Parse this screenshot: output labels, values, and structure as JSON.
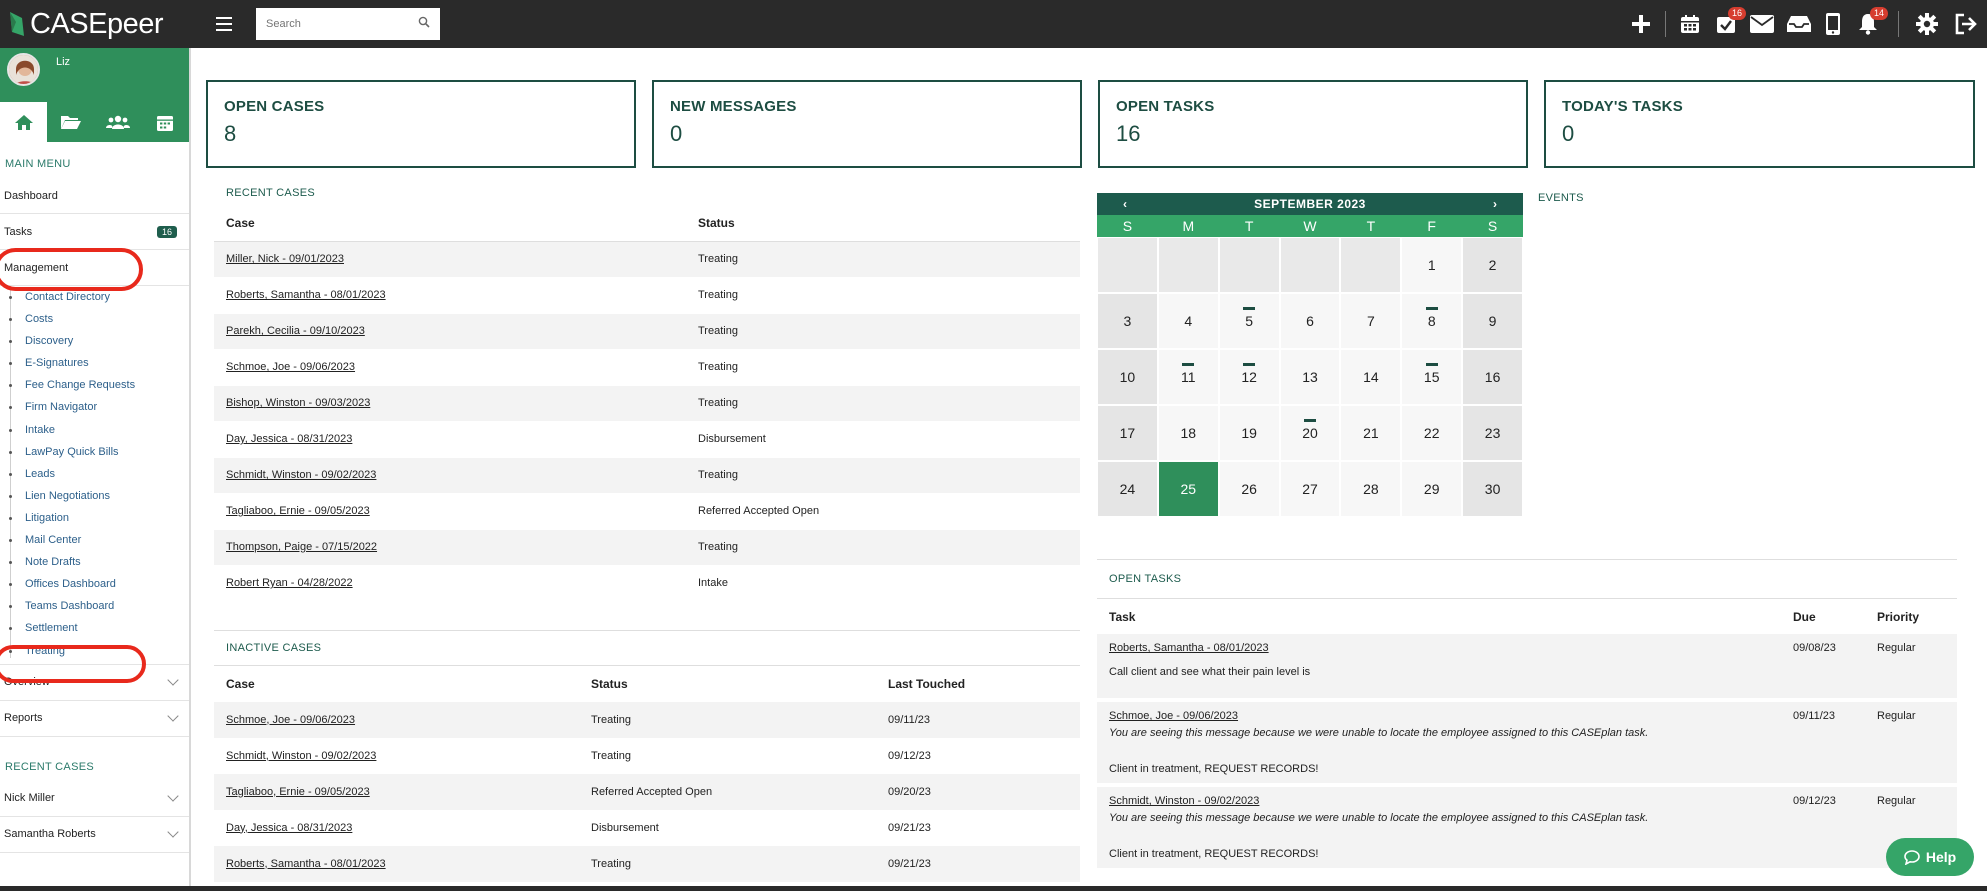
{
  "topbar": {
    "logo_text": "CASEpeer",
    "search_placeholder": "Search",
    "badge_tasks": "16",
    "badge_notifications": "14"
  },
  "sidebar": {
    "username": "Liz",
    "main_menu_label": "MAIN MENU",
    "items": {
      "dashboard": "Dashboard",
      "tasks": "Tasks",
      "tasks_count": "16",
      "management": "Management",
      "overview": "Overview",
      "reports": "Reports"
    },
    "management_sub": [
      "Contact Directory",
      "Costs",
      "Discovery",
      "E-Signatures",
      "Fee Change Requests",
      "Firm Navigator",
      "Intake",
      "LawPay Quick Bills",
      "Leads",
      "Lien Negotiations",
      "Litigation",
      "Mail Center",
      "Note Drafts",
      "Offices Dashboard",
      "Teams Dashboard",
      "Settlement",
      "Treating"
    ],
    "recent_cases_label": "RECENT CASES",
    "recent_cases": [
      "Nick Miller",
      "Samantha Roberts"
    ]
  },
  "stats": [
    {
      "label": "OPEN CASES",
      "value": "8"
    },
    {
      "label": "NEW MESSAGES",
      "value": "0"
    },
    {
      "label": "OPEN TASKS",
      "value": "16"
    },
    {
      "label": "TODAY'S TASKS",
      "value": "0"
    }
  ],
  "recent_cases": {
    "title": "RECENT CASES",
    "headers": [
      "Case",
      "Status"
    ],
    "rows": [
      [
        "Miller, Nick - 09/01/2023",
        "Treating"
      ],
      [
        "Roberts, Samantha - 08/01/2023",
        "Treating"
      ],
      [
        "Parekh, Cecilia - 09/10/2023",
        "Treating"
      ],
      [
        "Schmoe, Joe - 09/06/2023",
        "Treating"
      ],
      [
        "Bishop, Winston - 09/03/2023",
        "Treating"
      ],
      [
        "Day, Jessica - 08/31/2023",
        "Disbursement"
      ],
      [
        "Schmidt, Winston - 09/02/2023",
        "Treating"
      ],
      [
        "Tagliaboo, Ernie - 09/05/2023",
        "Referred Accepted Open"
      ],
      [
        "Thompson, Paige - 07/15/2022",
        "Treating"
      ],
      [
        "Robert Ryan - 04/28/2022",
        "Intake"
      ]
    ]
  },
  "inactive_cases": {
    "title": "INACTIVE CASES",
    "headers": [
      "Case",
      "Status",
      "Last Touched"
    ],
    "rows": [
      [
        "Schmoe, Joe - 09/06/2023",
        "Treating",
        "09/11/23"
      ],
      [
        "Schmidt, Winston - 09/02/2023",
        "Treating",
        "09/12/23"
      ],
      [
        "Tagliaboo, Ernie - 09/05/2023",
        "Referred Accepted Open",
        "09/20/23"
      ],
      [
        "Day, Jessica - 08/31/2023",
        "Disbursement",
        "09/21/23"
      ],
      [
        "Roberts, Samantha - 08/01/2023",
        "Treating",
        "09/21/23"
      ]
    ]
  },
  "calendar": {
    "prev": "‹",
    "next": "›",
    "month": "SEPTEMBER 2023",
    "weekdays": [
      "S",
      "M",
      "T",
      "W",
      "T",
      "F",
      "S"
    ],
    "leading_blanks": 5,
    "days": 30,
    "today": 25,
    "days_with_events": [
      5,
      8,
      11,
      12,
      15,
      20
    ]
  },
  "events_label": "EVENTS",
  "open_tasks": {
    "title": "OPEN TASKS",
    "headers": [
      "Task",
      "Due",
      "Priority"
    ],
    "rows": [
      {
        "case": "Roberts, Samantha - 08/01/2023",
        "warning": "",
        "note": "Call client and see what their pain level is",
        "due": "09/08/23",
        "priority": "Regular"
      },
      {
        "case": "Schmoe, Joe - 09/06/2023",
        "warning": "You are seeing this message because we were unable to locate the employee assigned to this CASEplan task.",
        "note": "Client in treatment, REQUEST RECORDS!",
        "due": "09/11/23",
        "priority": "Regular"
      },
      {
        "case": "Schmidt, Winston - 09/02/2023",
        "warning": "You are seeing this message because we were unable to locate the employee assigned to this CASEplan task.",
        "note": "Client in treatment, REQUEST RECORDS!",
        "due": "09/12/23",
        "priority": "Regular"
      }
    ]
  },
  "help_label": "Help",
  "colors": {
    "brand_green": "#2f8f5b",
    "dark_teal": "#1d4d42",
    "annotation_red": "#e8291c"
  }
}
